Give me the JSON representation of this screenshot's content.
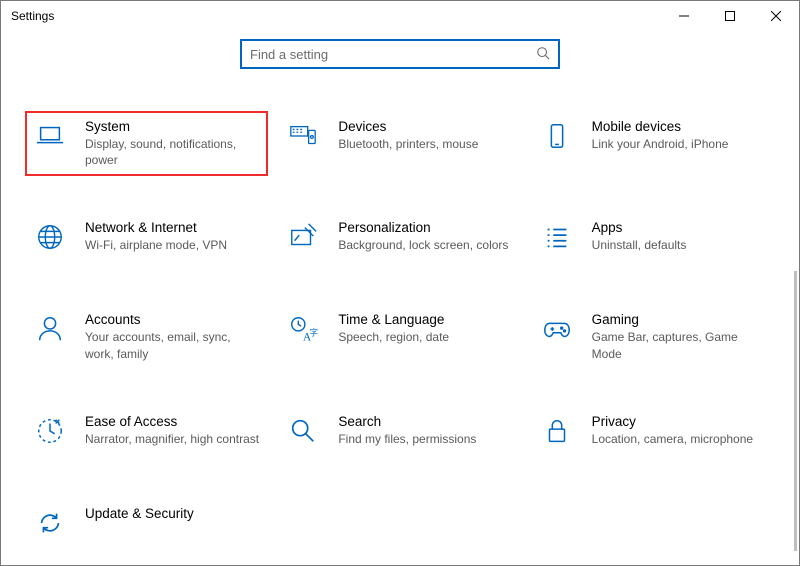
{
  "window": {
    "title": "Settings"
  },
  "search": {
    "placeholder": "Find a setting"
  },
  "categories": [
    {
      "key": "system",
      "title": "System",
      "sub": "Display, sound, notifications, power",
      "highlight": true
    },
    {
      "key": "devices",
      "title": "Devices",
      "sub": "Bluetooth, printers, mouse"
    },
    {
      "key": "phone",
      "title": "Mobile devices",
      "sub": "Link your Android, iPhone"
    },
    {
      "key": "network",
      "title": "Network & Internet",
      "sub": "Wi-Fi, airplane mode, VPN"
    },
    {
      "key": "personalize",
      "title": "Personalization",
      "sub": "Background, lock screen, colors"
    },
    {
      "key": "apps",
      "title": "Apps",
      "sub": "Uninstall, defaults"
    },
    {
      "key": "accounts",
      "title": "Accounts",
      "sub": "Your accounts, email, sync, work, family"
    },
    {
      "key": "time",
      "title": "Time & Language",
      "sub": "Speech, region, date"
    },
    {
      "key": "gaming",
      "title": "Gaming",
      "sub": "Game Bar, captures, Game Mode"
    },
    {
      "key": "ease",
      "title": "Ease of Access",
      "sub": "Narrator, magnifier, high contrast"
    },
    {
      "key": "search",
      "title": "Search",
      "sub": "Find my files, permissions"
    },
    {
      "key": "privacy",
      "title": "Privacy",
      "sub": "Location, camera, microphone"
    },
    {
      "key": "update",
      "title": "Update & Security",
      "sub": ""
    }
  ]
}
